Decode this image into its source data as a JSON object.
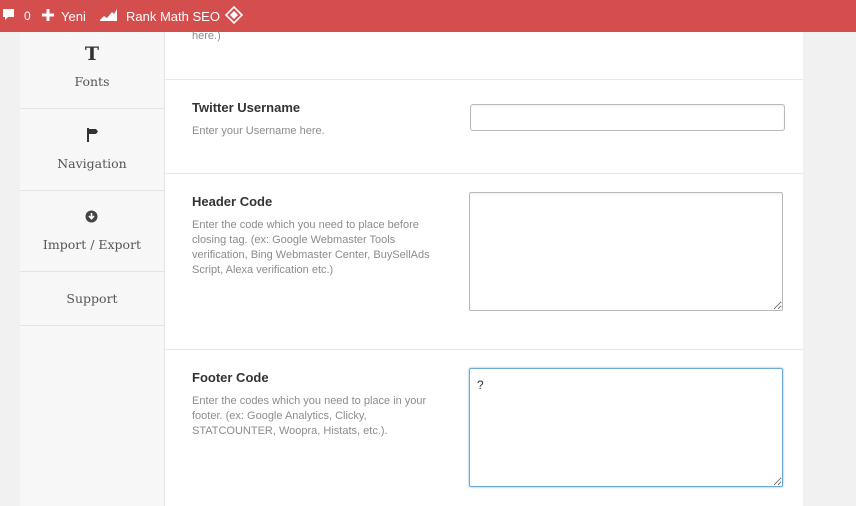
{
  "adminbar": {
    "comments_count": "0",
    "new_label": "Yeni",
    "rankmath_label": "Rank Math SEO",
    "bg_color": "#d54e4e"
  },
  "sidebar": {
    "items": [
      {
        "icon": "T",
        "label": "Fonts"
      },
      {
        "icon": "signpost-icon",
        "label": "Navigation"
      },
      {
        "icon": "arrow-down-circle-icon",
        "label": "Import / Export"
      },
      {
        "icon": "",
        "label": "Support"
      }
    ]
  },
  "main": {
    "top_desc": "here.)",
    "twitter": {
      "title": "Twitter Username",
      "desc": "Enter your Username here.",
      "value": ""
    },
    "header_code": {
      "title": "Header Code",
      "desc": "Enter the code which you need to place before closing tag. (ex: Google Webmaster Tools verification, Bing Webmaster Center, BuySellAds Script, Alexa verification etc.)",
      "value": ""
    },
    "footer_code": {
      "title": "Footer Code",
      "desc": "Enter the codes which you need to place in your footer. (ex: Google Analytics, Clicky, STATCOUNTER, Woopra, Histats, etc.).",
      "value": "?"
    }
  }
}
